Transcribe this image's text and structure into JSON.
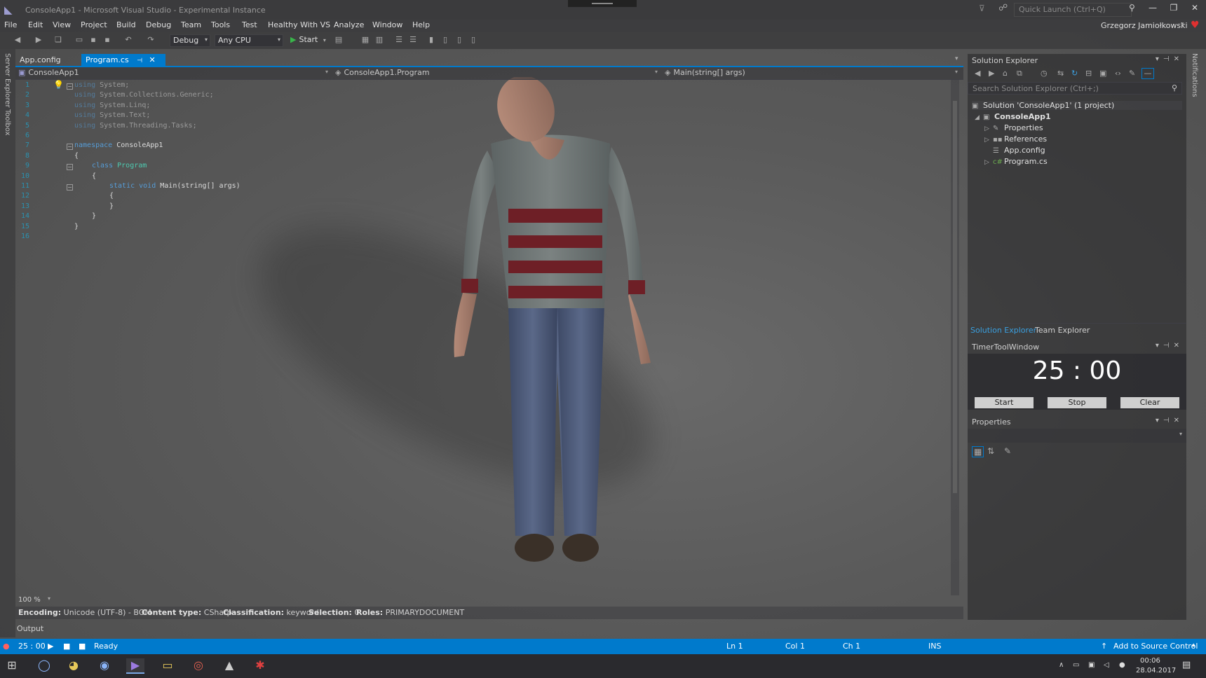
{
  "window": {
    "title": "ConsoleApp1 - Microsoft Visual Studio - Experimental Instance",
    "quick_launch_placeholder": "Quick Launch (Ctrl+Q)",
    "user": "Grzegorz Jamiołkowski"
  },
  "menu": [
    "File",
    "Edit",
    "View",
    "Project",
    "Build",
    "Debug",
    "Team",
    "Tools",
    "Test",
    "Healthy With VS",
    "Analyze",
    "Window",
    "Help"
  ],
  "toolbar": {
    "configuration": "Debug",
    "platform": "Any CPU",
    "start_label": "Start"
  },
  "sidebar": {
    "left_tabs": [
      "Server Explorer",
      "Toolbox"
    ],
    "right_tab": "Notifications"
  },
  "tabs": [
    {
      "label": "App.config",
      "active": false
    },
    {
      "label": "Program.cs",
      "active": true
    }
  ],
  "navbar": {
    "project": "ConsoleApp1",
    "type": "ConsoleApp1.Program",
    "member": "Main(string[] args)"
  },
  "code": {
    "line_numbers": [
      "1",
      "2",
      "3",
      "4",
      "5",
      "6",
      "7",
      "8",
      "9",
      "10",
      "11",
      "12",
      "13",
      "14",
      "15",
      "16"
    ],
    "lines": [
      {
        "kw": "using",
        "rest": " System;"
      },
      {
        "kw": "using",
        "rest": " System.Collections.Generic;"
      },
      {
        "kw": "using",
        "rest": " System.Linq;"
      },
      {
        "kw": "using",
        "rest": " System.Text;"
      },
      {
        "kw": "using",
        "rest": " System.Threading.Tasks;"
      },
      {
        "kw": "",
        "rest": ""
      },
      {
        "kw": "namespace",
        "rest": " ConsoleApp1"
      },
      {
        "kw": "",
        "rest": "{"
      },
      {
        "kw": "class",
        "rest": " Program"
      },
      {
        "kw": "",
        "rest": "{"
      },
      {
        "kw": "static void",
        "rest": " Main(string[] args)"
      },
      {
        "kw": "",
        "rest": "{"
      },
      {
        "kw": "",
        "rest": "}"
      },
      {
        "kw": "",
        "rest": "}"
      },
      {
        "kw": "",
        "rest": "}"
      },
      {
        "kw": "",
        "rest": ""
      }
    ]
  },
  "editor_footer": {
    "zoom": "100 %",
    "encoding_label": "Encoding:",
    "encoding": "Unicode (UTF-8) - BOM",
    "content_type_label": "Content type:",
    "content_type": "CSharp",
    "classification_label": "Classification:",
    "classification": "keyword",
    "selection_label": "Selection:",
    "selection": "0",
    "roles_label": "Roles:",
    "roles": "PRIMARYDOCUMENT",
    "output_label": "Output"
  },
  "solution_explorer": {
    "title": "Solution Explorer",
    "search_placeholder": "Search Solution Explorer (Ctrl+;)",
    "solution": "Solution 'ConsoleApp1' (1 project)",
    "project": "ConsoleApp1",
    "items": [
      "Properties",
      "References",
      "App.config",
      "Program.cs"
    ],
    "bottom_tabs": [
      "Solution Explorer",
      "Team Explorer"
    ]
  },
  "timer_window": {
    "title": "TimerToolWindow",
    "time": "25 : 00",
    "buttons": [
      "Start",
      "Stop",
      "Clear"
    ]
  },
  "properties": {
    "title": "Properties"
  },
  "statusbar": {
    "timer": "25 : 00",
    "state": "Ready",
    "ln": "Ln 1",
    "col": "Col 1",
    "ch": "Ch 1",
    "mode": "INS",
    "source_control": "Add to Source Control"
  },
  "taskbar": {
    "time": "00:06",
    "date": "28.04.2017"
  },
  "colors": {
    "accent": "#007acc",
    "keyword": "#569cd6",
    "type": "#4ec9b0",
    "line_number": "#2b91af"
  }
}
